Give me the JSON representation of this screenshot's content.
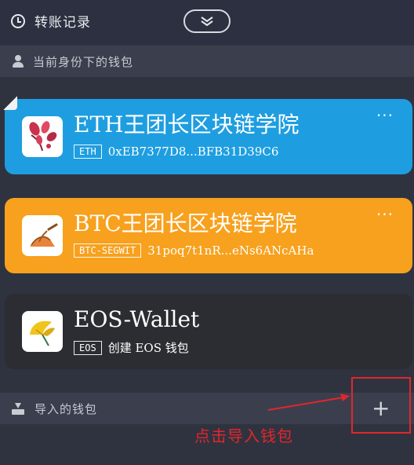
{
  "header": {
    "history_label": "转账记录",
    "history_icon": "clock-icon",
    "collapse_icon": "chevron-down-icon"
  },
  "identity_section": {
    "label": "当前身份下的钱包",
    "icon": "person-icon"
  },
  "wallets": [
    {
      "name": "ETH王团长区块链学院",
      "chain": "ETH",
      "address": "0xEB7377D8...BFB31D39C6",
      "color": "#1e9ee0",
      "more": "···"
    },
    {
      "name": "BTC王团长区块链学院",
      "chain": "BTC-SEGWIT",
      "address": "31poq7t1nR...eNs6ANcAHa",
      "color": "#f7a11e",
      "more": "···"
    },
    {
      "name": "EOS-Wallet",
      "chain": "EOS",
      "address": "创建 EOS 钱包",
      "color": "#2c2d32"
    }
  ],
  "import_section": {
    "label": "导入的钱包",
    "icon": "import-icon",
    "add": "+"
  },
  "annotation": {
    "text": "点击导入钱包",
    "color": "#e2262b"
  }
}
